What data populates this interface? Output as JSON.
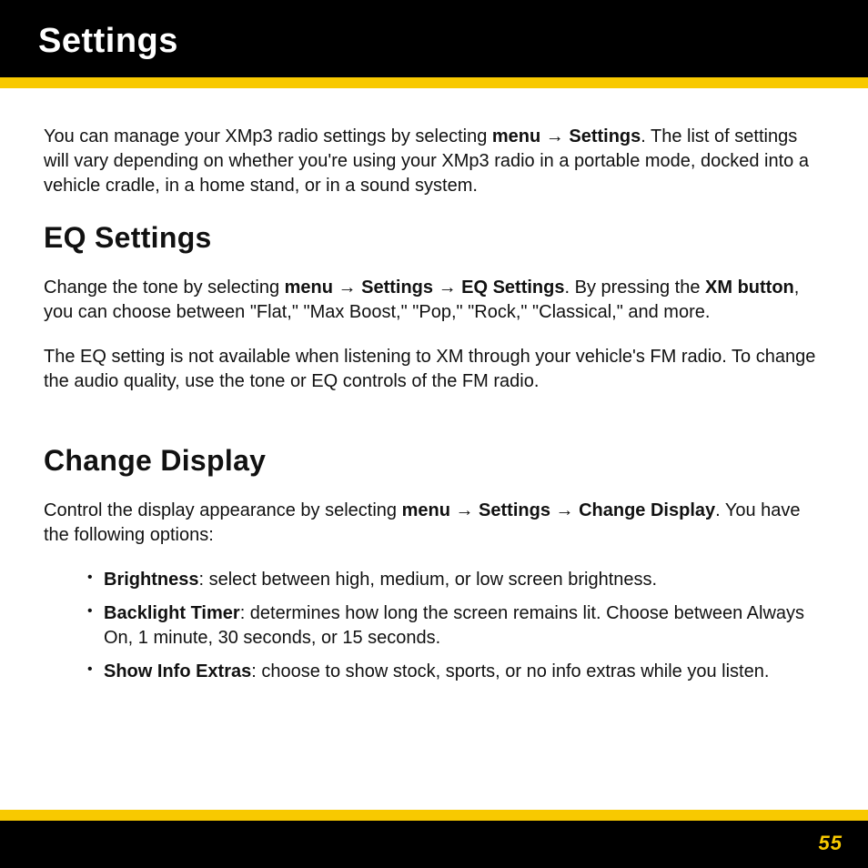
{
  "header": {
    "title": "Settings"
  },
  "intro": {
    "t1": "You can manage your XMp3 radio settings by selecting ",
    "b1": "menu",
    "arrow": " → ",
    "b2": "Settings",
    "t2": ". The list of settings will vary depending on whether you're using your XMp3 radio in a portable mode, docked into a vehicle cradle, in a home stand, or in a sound system."
  },
  "eq": {
    "heading": "EQ Settings",
    "p1": {
      "t1": "Change the tone by selecting ",
      "b1": "menu",
      "arrow1": " → ",
      "b2": "Settings",
      "arrow2": " → ",
      "b3": "EQ Settings",
      "t2": ". By pressing the ",
      "b4": "XM button",
      "t3": ", you can choose between \"Flat,\" \"Max Boost,\" \"Pop,\" \"Rock,\" \"Classical,\" and more."
    },
    "p2": "The EQ setting is not available when listening to XM through your vehicle's FM radio. To change the audio quality, use the tone or EQ controls of the FM radio."
  },
  "display": {
    "heading": "Change Display",
    "p1": {
      "t1": "Control the display appearance by selecting ",
      "b1": "menu",
      "arrow1": " → ",
      "b2": "Settings",
      "arrow2": " → ",
      "b3": "Change Display",
      "t2": ". You have the following options:"
    },
    "items": [
      {
        "name": "Brightness",
        "desc": ": select between high, medium, or low screen brightness."
      },
      {
        "name": "Backlight Timer",
        "desc": ": determines how long the screen remains lit. Choose between Always On, 1 minute, 30 seconds, or 15 seconds."
      },
      {
        "name": "Show Info Extras",
        "desc": ": choose to show stock, sports, or no info extras while you listen."
      }
    ]
  },
  "footer": {
    "page_number": "55"
  }
}
